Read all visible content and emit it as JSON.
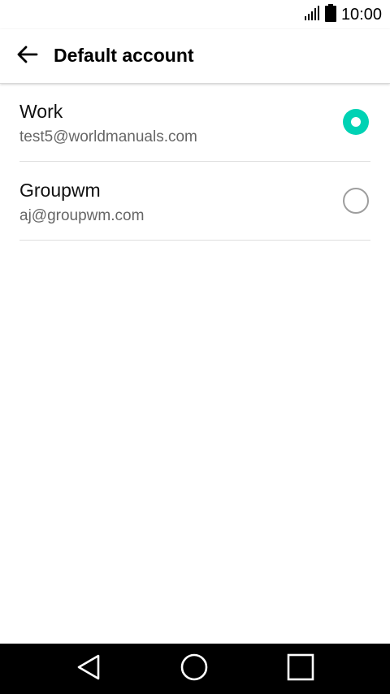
{
  "status_bar": {
    "time": "10:00",
    "icons": [
      "signal-icon",
      "battery-icon"
    ]
  },
  "app_bar": {
    "back_icon": "arrow-back-icon",
    "title": "Default account"
  },
  "accounts": [
    {
      "name": "Work",
      "email": "test5@worldmanuals.com",
      "selected": true
    },
    {
      "name": "Groupwm",
      "email": "aj@groupwm.com",
      "selected": false
    }
  ],
  "nav_bar": {
    "icons": [
      "back-triangle-icon",
      "home-circle-icon",
      "recents-square-icon"
    ]
  },
  "colors": {
    "accent": "#00d2b4",
    "nav_background": "#000000",
    "secondary_text": "#666666"
  }
}
